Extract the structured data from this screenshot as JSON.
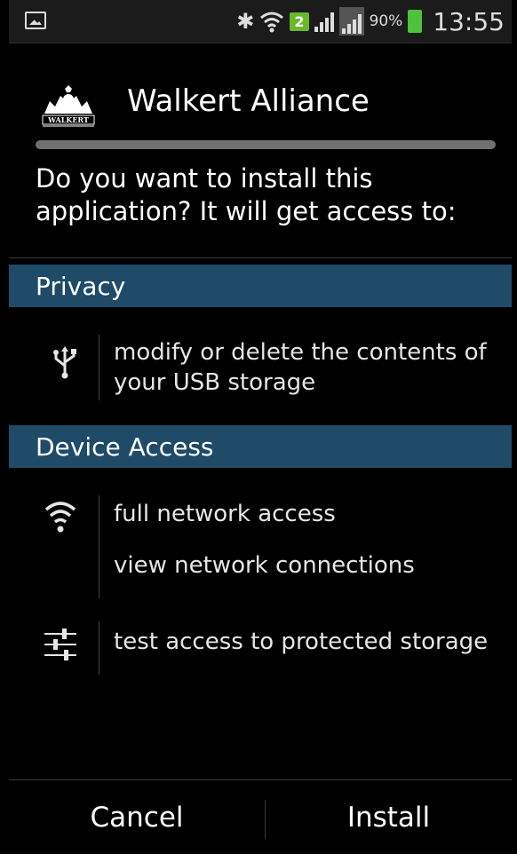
{
  "status_bar": {
    "sim_badge": "2",
    "battery_percent": "90%",
    "time": "13:55"
  },
  "app": {
    "name": "Walkert Alliance",
    "logo_text": "WALKERT"
  },
  "prompt": "Do you want to install this application? It will get access to:",
  "sections": [
    {
      "title": "Privacy",
      "permissions": [
        {
          "icon": "usb-icon",
          "lines": [
            "modify or delete the contents of",
            "your USB storage"
          ]
        }
      ]
    },
    {
      "title": "Device Access",
      "permissions": [
        {
          "icon": "wifi-icon",
          "lines": [
            "full network access",
            "view network connections"
          ]
        },
        {
          "icon": "sliders-icon",
          "lines": [
            "test access to protected storage"
          ]
        }
      ]
    }
  ],
  "buttons": {
    "cancel": "Cancel",
    "install": "Install"
  },
  "colors": {
    "section_header_bg": "#1f4a68",
    "background": "#000000",
    "battery": "#4ec23a",
    "sim_badge": "#6ab82b"
  }
}
